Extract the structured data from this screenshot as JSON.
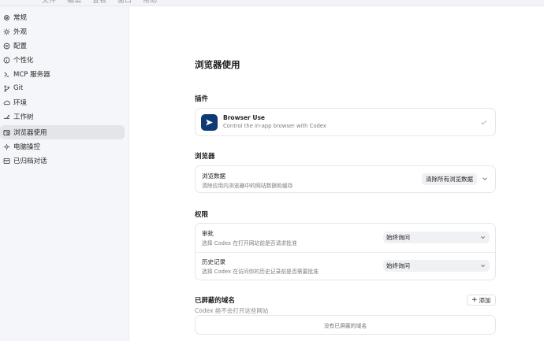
{
  "menubar": {
    "items": [
      "文件",
      "编辑",
      "查看",
      "窗口",
      "帮助"
    ]
  },
  "sidebar": {
    "items": [
      {
        "label": "常规",
        "icon": "gear-icon"
      },
      {
        "label": "外观",
        "icon": "sun-icon"
      },
      {
        "label": "配置",
        "icon": "config-icon"
      },
      {
        "label": "个性化",
        "icon": "info-icon"
      },
      {
        "label": "MCP 服务器",
        "icon": "server-icon"
      },
      {
        "label": "Git",
        "icon": "git-branch-icon"
      },
      {
        "label": "环境",
        "icon": "cloud-icon"
      },
      {
        "label": "工作树",
        "icon": "worktree-icon"
      },
      {
        "label": "浏览器使用",
        "icon": "browser-icon",
        "active": true
      },
      {
        "label": "电脑操控",
        "icon": "cursor-icon"
      },
      {
        "label": "已归档对话",
        "icon": "archive-icon"
      }
    ]
  },
  "main": {
    "title": "浏览器使用",
    "plugins": {
      "section_title": "插件",
      "name": "Browser Use",
      "description": "Control the in-app browser with Codex",
      "status_icon": "check-icon",
      "logo_color": "#0d3a73"
    },
    "browser": {
      "section_title": "浏览器",
      "data_title": "浏览数据",
      "data_sub": "清除应用内浏览器中的网站数据和缓存",
      "clear_button": "清除所有浏览数据"
    },
    "permissions": {
      "section_title": "权限",
      "approval_title": "审批",
      "approval_sub": "选择 Codex 在打开网站前是否请求批准",
      "approval_value": "始终询问",
      "history_title": "历史记录",
      "history_sub": "选择 Codex 在访问你的历史记录前是否需要批准",
      "history_value": "始终询问"
    },
    "blocked": {
      "section_title": "已屏蔽的域名",
      "subtitle": "Codex 绝不会打开这些网站",
      "add_button": "添加",
      "empty_text": "没有已屏蔽的域名"
    }
  },
  "colors": {
    "sidebar_bg": "#f5f6f9",
    "active_item_bg": "#e4e5ea",
    "select_bg": "#f0f1f4"
  }
}
